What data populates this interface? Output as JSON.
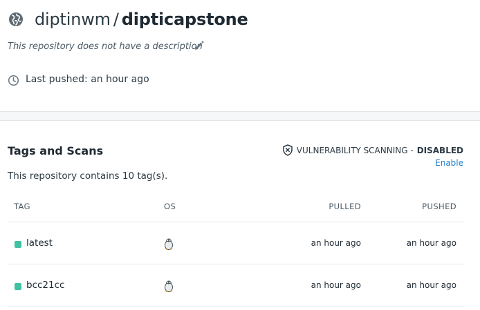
{
  "repo": {
    "namespace": "diptinwm",
    "separator": "/",
    "name": "dipticapstone",
    "description": "This repository does not have a description",
    "last_pushed": "Last pushed: an hour ago",
    "icons": {
      "visibility": "globe-icon",
      "edit": "pencil-icon",
      "time": "clock-icon"
    }
  },
  "tags_section": {
    "title": "Tags and Scans",
    "count_text": "This repository contains 10 tag(s).",
    "vulnerability": {
      "label": "VULNERABILITY SCANNING -",
      "status": "DISABLED",
      "enable_link": "Enable",
      "icon": "shield-x-icon"
    },
    "columns": [
      "TAG",
      "OS",
      "PULLED",
      "PUSHED"
    ],
    "rows": [
      {
        "tag": "latest",
        "os": "linux",
        "pulled": "an hour ago",
        "pushed": "an hour ago"
      },
      {
        "tag": "bcc21cc",
        "os": "linux",
        "pulled": "an hour ago",
        "pushed": "an hour ago"
      }
    ]
  },
  "colors": {
    "link": "#1e7ecb",
    "tag_dot": "#3fc1a2",
    "divider": "#e3e6e8",
    "text": "#1f2a33"
  }
}
